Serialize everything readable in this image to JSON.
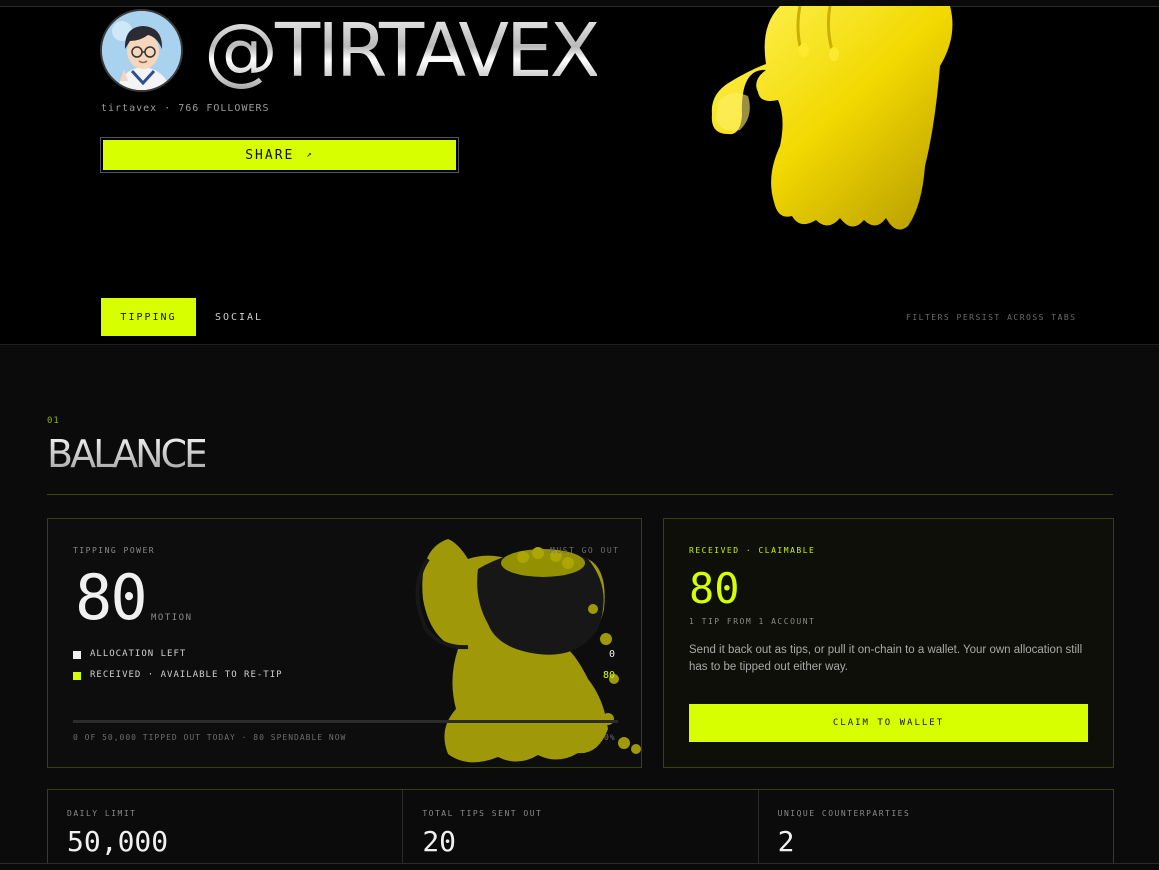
{
  "profile": {
    "handle": "@TIRTAVEX",
    "username": "tirtavex",
    "followers_text": "766 FOLLOWERS",
    "meta_separator": "·",
    "share_label": "SHARE",
    "share_icon": "↗"
  },
  "tabs": {
    "items": [
      {
        "label": "TIPPING",
        "active": true
      },
      {
        "label": "SOCIAL",
        "active": false
      }
    ],
    "note": "FILTERS PERSIST ACROSS TABS"
  },
  "section": {
    "number": "01",
    "title": "BALANCE"
  },
  "tipping_power": {
    "label": "TIPPING POWER",
    "corner_note": "MUST GO OUT",
    "value": "80",
    "unit": "MOTION",
    "legend": [
      {
        "label": "ALLOCATION LEFT",
        "value": "0",
        "color": "#f0f0f0"
      },
      {
        "label": "RECEIVED · AVAILABLE TO RE-TIP",
        "value": "80",
        "color": "#d7ff00"
      }
    ],
    "progress_fraction": 0,
    "footer": "0 OF 50,000 TIPPED OUT TODAY · 80 SPENDABLE NOW",
    "footer_right": "0%"
  },
  "claimable": {
    "label": "RECEIVED · CLAIMABLE",
    "value": "80",
    "sub": "1 TIP FROM 1 ACCOUNT",
    "description": "Send it back out as tips, or pull it on-chain to a wallet. Your own allocation still has to be tipped out either way.",
    "button_label": "CLAIM TO WALLET"
  },
  "stats": [
    {
      "label": "DAILY LIMIT",
      "value": "50,000"
    },
    {
      "label": "TOTAL TIPS SENT OUT",
      "value": "20"
    },
    {
      "label": "UNIQUE COUNTERPARTIES",
      "value": "2"
    }
  ],
  "colors": {
    "accent": "#d7ff00",
    "background": "#000000",
    "panel": "#0b0b0b"
  }
}
